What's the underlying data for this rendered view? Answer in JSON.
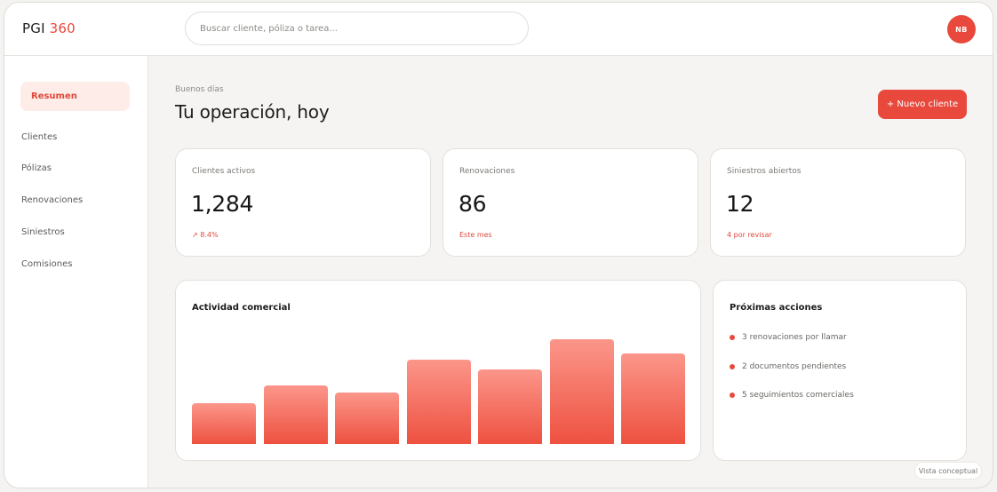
{
  "header": {
    "logo_text": "PGI",
    "logo_accent": "360",
    "search_placeholder": "Buscar cliente, póliza o tarea...",
    "avatar_initials": "NB"
  },
  "sidebar": {
    "items": [
      {
        "label": "Resumen",
        "active": true
      },
      {
        "label": "Clientes"
      },
      {
        "label": "Pólizas"
      },
      {
        "label": "Renovaciones"
      },
      {
        "label": "Siniestros"
      },
      {
        "label": "Comisiones"
      }
    ]
  },
  "main": {
    "greeting": "Buenos días",
    "title": "Tu operación, hoy",
    "new_client_button": "+ Nuevo cliente",
    "stats": [
      {
        "label": "Clientes activos",
        "value": "1,284",
        "sub": "↗ 8.4%"
      },
      {
        "label": "Renovaciones",
        "value": "86",
        "sub": "Este mes"
      },
      {
        "label": "Siniestros abiertos",
        "value": "12",
        "sub": "4 por revisar"
      }
    ],
    "activity": {
      "title": "Actividad comercial"
    },
    "next_actions": {
      "title": "Próximas acciones",
      "items": [
        "3 renovaciones por llamar",
        "2 documentos pendientes",
        "5 seguimientos comerciales"
      ]
    },
    "badge": "Vista conceptual"
  },
  "colors": {
    "accent": "#e8493c",
    "accent_soft": "#fdece8"
  },
  "chart_data": {
    "type": "bar",
    "title": "Actividad comercial",
    "values": [
      38,
      55,
      48,
      79,
      70,
      98,
      85
    ],
    "ylim": [
      0,
      100
    ]
  }
}
